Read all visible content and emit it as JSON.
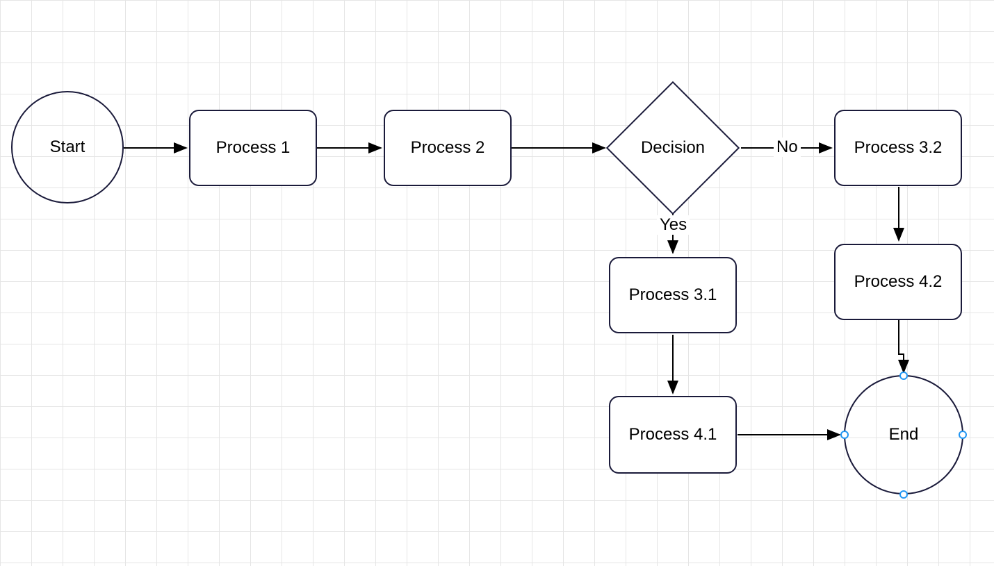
{
  "nodes": {
    "start": {
      "label": "Start"
    },
    "process1": {
      "label": "Process 1"
    },
    "process2": {
      "label": "Process 2"
    },
    "decision": {
      "label": "Decision"
    },
    "process31": {
      "label": "Process 3.1"
    },
    "process32": {
      "label": "Process 3.2"
    },
    "process41": {
      "label": "Process 4.1"
    },
    "process42": {
      "label": "Process 4.2"
    },
    "end": {
      "label": "End"
    }
  },
  "edges": {
    "decision_yes": {
      "label": "Yes"
    },
    "decision_no": {
      "label": "No"
    }
  },
  "selection": {
    "selected_node": "end"
  },
  "colors": {
    "stroke": "#1a1a3a",
    "handle": "#2196f3",
    "grid": "#e5e5e5"
  }
}
